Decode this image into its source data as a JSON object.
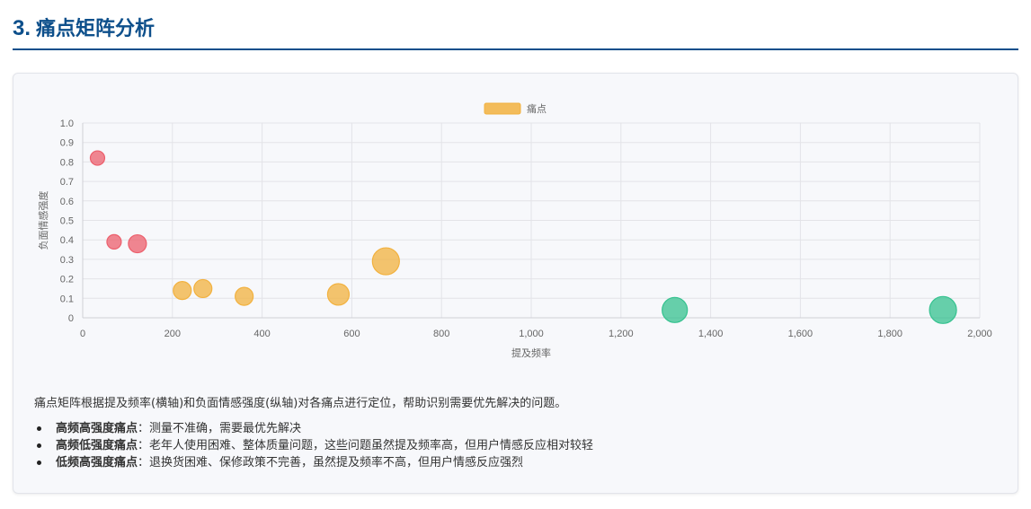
{
  "section": {
    "number": "3.",
    "title": "痛点矩阵分析"
  },
  "chart_data": {
    "type": "scatter",
    "legend": [
      "痛点"
    ],
    "legend_position": "top-center",
    "xlabel": "提及频率",
    "ylabel": "负面情感强度",
    "xlim": [
      0,
      2000
    ],
    "ylim": [
      0,
      1.0
    ],
    "x_ticks": [
      "0",
      "200",
      "400",
      "600",
      "800",
      "1,000",
      "1,200",
      "1,400",
      "1,600",
      "1,800",
      "2,000"
    ],
    "y_ticks": [
      "0",
      "0.1",
      "0.2",
      "0.3",
      "0.4",
      "0.5",
      "0.6",
      "0.7",
      "0.8",
      "0.9",
      "1.0"
    ],
    "grid": true,
    "colors": {
      "red": "#ec5f6c",
      "orange": "#f2b13e",
      "green": "#35c28f",
      "legend": "#f2b13e"
    },
    "points": [
      {
        "x": 33,
        "y": 0.82,
        "r": 8,
        "color": "red"
      },
      {
        "x": 70,
        "y": 0.39,
        "r": 8,
        "color": "red"
      },
      {
        "x": 122,
        "y": 0.38,
        "r": 10,
        "color": "red"
      },
      {
        "x": 222,
        "y": 0.14,
        "r": 10,
        "color": "orange"
      },
      {
        "x": 268,
        "y": 0.15,
        "r": 10,
        "color": "orange"
      },
      {
        "x": 360,
        "y": 0.11,
        "r": 10,
        "color": "orange"
      },
      {
        "x": 570,
        "y": 0.12,
        "r": 12,
        "color": "orange"
      },
      {
        "x": 676,
        "y": 0.29,
        "r": 15,
        "color": "orange"
      },
      {
        "x": 1320,
        "y": 0.04,
        "r": 14,
        "color": "green"
      },
      {
        "x": 1918,
        "y": 0.04,
        "r": 15,
        "color": "green"
      }
    ]
  },
  "description": "痛点矩阵根据提及频率(横轴)和负面情感强度(纵轴)对各痛点进行定位，帮助识别需要优先解决的问题。",
  "items": [
    {
      "label": "高频高强度痛点",
      "text": "：测量不准确，需要最优先解决"
    },
    {
      "label": "高频低强度痛点",
      "text": "：老年人使用困难、整体质量问题，这些问题虽然提及频率高，但用户情感反应相对较轻"
    },
    {
      "label": "低频高强度痛点",
      "text": "：退换货困难、保修政策不完善，虽然提及频率不高，但用户情感反应强烈"
    }
  ]
}
